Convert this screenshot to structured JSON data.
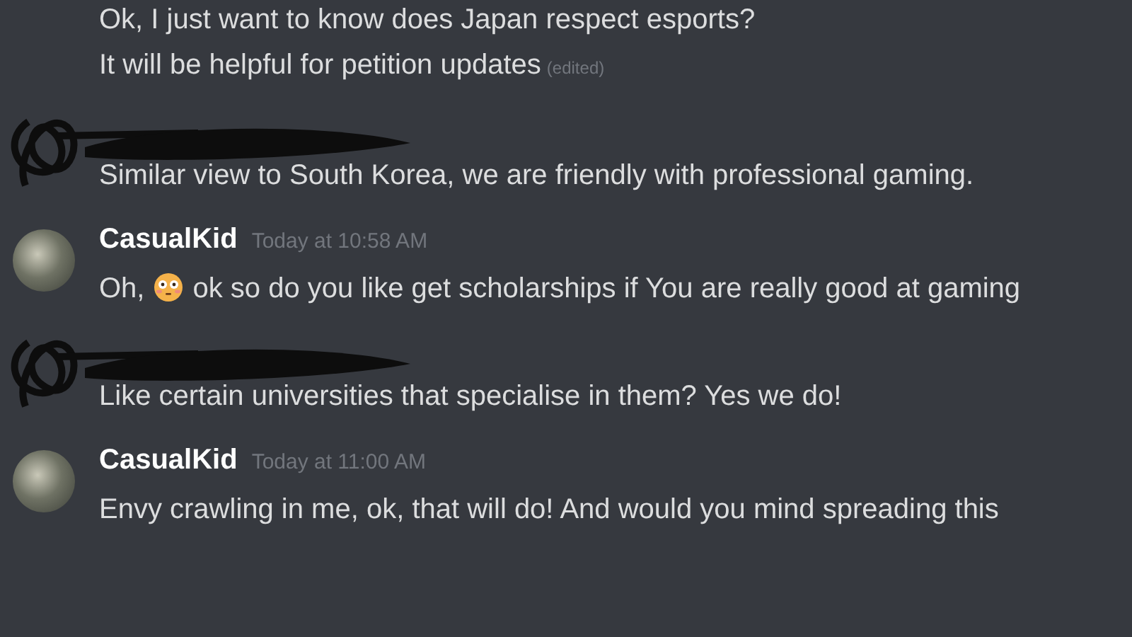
{
  "messages": [
    {
      "kind": "continued",
      "lines": [
        {
          "parts": [
            "Ok, I just want to know does Japan respect esports?"
          ]
        },
        {
          "parts": [
            "It will be helpful for petition updates"
          ],
          "edited": "(edited)"
        }
      ]
    },
    {
      "kind": "redacted",
      "lines": [
        {
          "parts": [
            "Similar view to South Korea, we are friendly with professional gaming."
          ]
        }
      ]
    },
    {
      "kind": "user",
      "author": "CasualKid",
      "time": "Today at 10:58 AM",
      "lines": [
        {
          "parts": [
            "Oh,",
            "ok so do you like get scholarships if You are really good at gaming"
          ]
        }
      ]
    },
    {
      "kind": "redacted",
      "lines": [
        {
          "parts": [
            "Like certain universities that specialise in them? Yes we do!"
          ]
        }
      ]
    },
    {
      "kind": "user",
      "author": "CasualKid",
      "time": "Today at 11:00 AM",
      "lines": [
        {
          "parts": [
            "Envy crawling in me, ok, that will do! And would you mind spreading this"
          ]
        }
      ]
    }
  ]
}
